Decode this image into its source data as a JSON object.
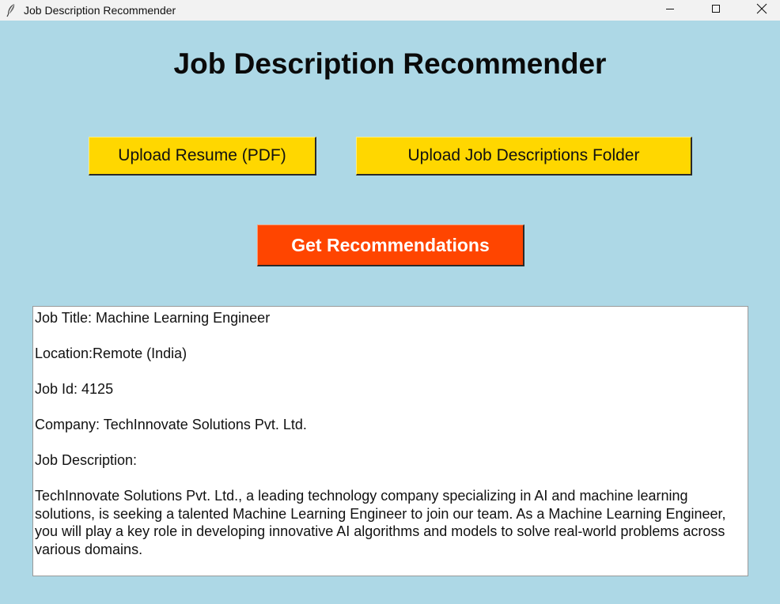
{
  "window": {
    "title": "Job Description Recommender",
    "icon": "feather-icon",
    "controls": [
      "minimize-icon",
      "maximize-icon",
      "close-icon"
    ]
  },
  "heading": "Job Description Recommender",
  "buttons": {
    "upload_resume": "Upload Resume (PDF)",
    "upload_folder": "Upload Job Descriptions Folder",
    "get_recommendations": "Get Recommendations"
  },
  "result": {
    "job_title": "Job Title: Machine Learning Engineer",
    "location": "Location:Remote (India)",
    "job_id": "Job Id: 4125",
    "company": "Company: TechInnovate Solutions Pvt. Ltd.",
    "description_label": "Job Description:",
    "description": "TechInnovate Solutions Pvt. Ltd., a leading technology company specializing in AI and machine learning solutions, is seeking a talented Machine Learning Engineer to join our team. As a Machine Learning Engineer, you will play a key role in developing innovative AI algorithms and models to solve real-world problems across various domains."
  },
  "colors": {
    "background": "#add8e6",
    "upload_button": "#ffd700",
    "recommend_button": "#ff4500",
    "recommend_text": "#ffffff"
  }
}
